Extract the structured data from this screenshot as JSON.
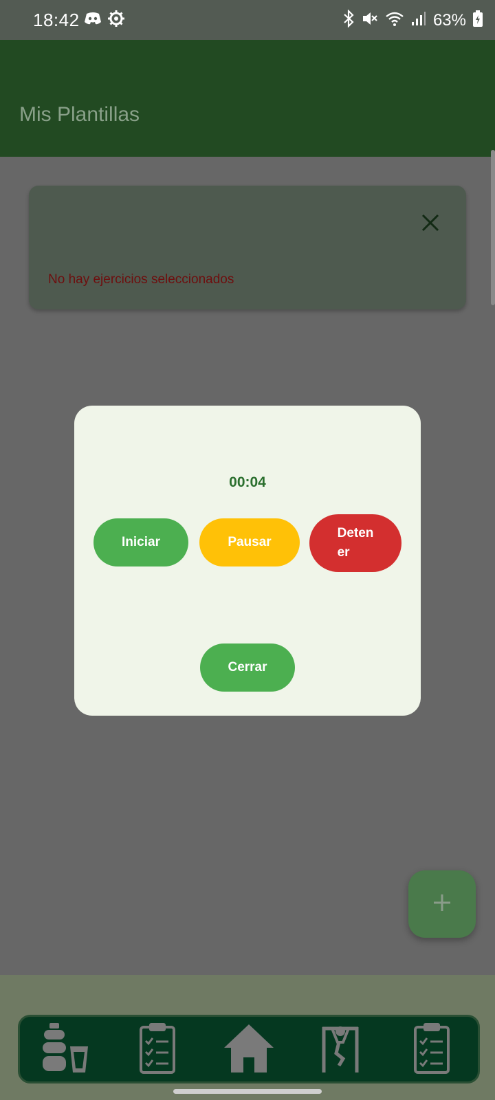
{
  "status_bar": {
    "time": "18:42",
    "left_icons": [
      "discord-icon",
      "settings-gear-icon"
    ],
    "right_icons": [
      "bluetooth-icon",
      "mute-icon",
      "wifi-icon",
      "signal-icon"
    ],
    "battery": "63%"
  },
  "app_bar": {
    "title": "Mis Plantillas"
  },
  "template_card": {
    "message": "No hay ejercicios seleccionados",
    "close_icon": "close-icon"
  },
  "timer_dialog": {
    "time": "00:04",
    "start_label": "Iniciar",
    "pause_label": "Pausar",
    "stop_label": "Deten\ner",
    "close_label": "Cerrar"
  },
  "fab": {
    "icon": "plus-icon"
  },
  "bottom_nav": {
    "items": [
      {
        "icon": "hydration-icon"
      },
      {
        "icon": "checklist-icon"
      },
      {
        "icon": "home-icon"
      },
      {
        "icon": "exercise-icon"
      },
      {
        "icon": "clipboard-checklist-icon"
      }
    ]
  },
  "colors": {
    "app_bar": "#224a22",
    "nav_bar": "#053820",
    "start_button": "#4caf50",
    "pause_button": "#ffc107",
    "stop_button": "#d32f2f",
    "timer_text": "#2b6f2e",
    "error_text": "#6e0e0e"
  }
}
